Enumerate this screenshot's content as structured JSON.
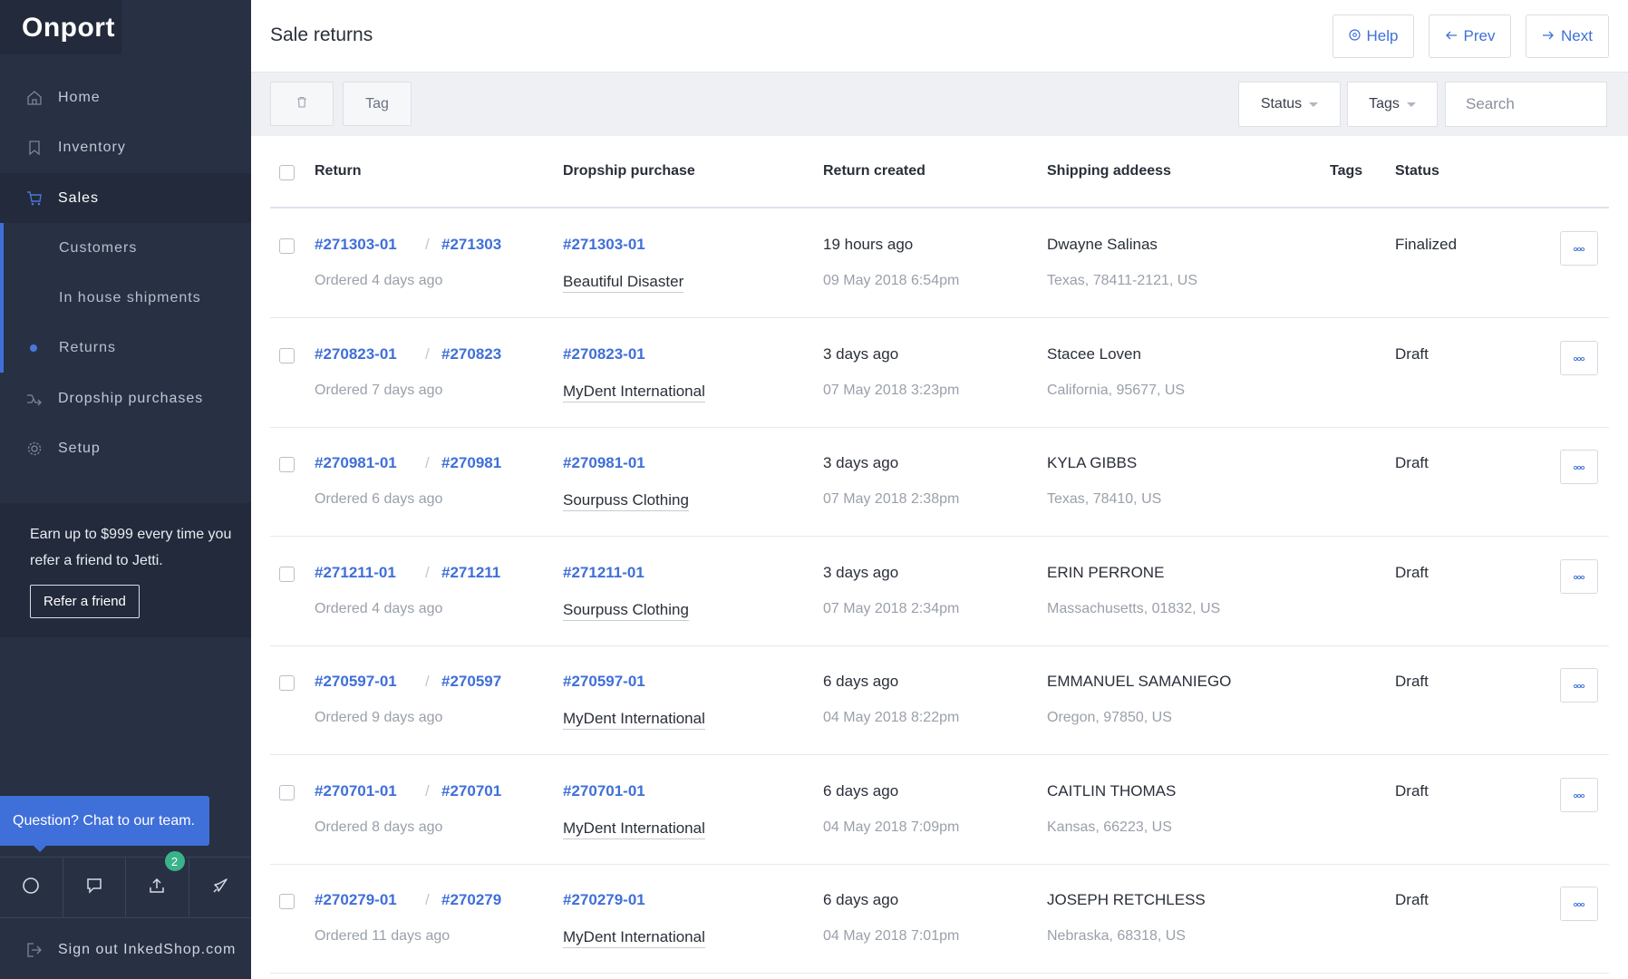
{
  "app": {
    "brand": "Onport"
  },
  "sidebar": {
    "items": [
      {
        "label": "Home",
        "icon": "home-icon"
      },
      {
        "label": "Inventory",
        "icon": "bookmark-icon"
      },
      {
        "label": "Sales",
        "icon": "cart-icon"
      },
      {
        "label": "Customers"
      },
      {
        "label": "In house shipments"
      },
      {
        "label": "Returns"
      },
      {
        "label": "Dropship purchases",
        "icon": "dropship-icon"
      },
      {
        "label": "Setup",
        "icon": "gear-icon"
      }
    ],
    "promo": {
      "text": "Earn up to $999 every time you refer a friend to Jetti.",
      "button": "Refer a friend"
    },
    "chat": "Question? Chat to our team.",
    "notification_count": "2",
    "signout": "Sign out InkedShop.com"
  },
  "header": {
    "title": "Sale returns",
    "help": "Help",
    "prev": "Prev",
    "next": "Next"
  },
  "toolbar": {
    "tag": "Tag",
    "status": "Status",
    "tags": "Tags",
    "search_placeholder": "Search"
  },
  "table": {
    "columns": {
      "return": "Return",
      "dropship": "Dropship purchase",
      "created": "Return created",
      "address": "Shipping addeess",
      "tags": "Tags",
      "status": "Status"
    },
    "rows": [
      {
        "return_id": "#271303-01",
        "order_id": "#271303",
        "ordered": "Ordered 4 days ago",
        "dropship_id": "#271303-01",
        "vendor": "Beautiful Disaster",
        "created": "19 hours ago",
        "created_date": "09 May 2018 6:54pm",
        "name": "Dwayne Salinas",
        "region": "Texas, 78411-2121, US",
        "status": "Finalized"
      },
      {
        "return_id": "#270823-01",
        "order_id": "#270823",
        "ordered": "Ordered 7 days ago",
        "dropship_id": "#270823-01",
        "vendor": "MyDent International",
        "created": "3 days ago",
        "created_date": "07 May 2018 3:23pm",
        "name": "Stacee Loven",
        "region": "California, 95677, US",
        "status": "Draft"
      },
      {
        "return_id": "#270981-01",
        "order_id": "#270981",
        "ordered": "Ordered 6 days ago",
        "dropship_id": "#270981-01",
        "vendor": "Sourpuss Clothing",
        "created": "3 days ago",
        "created_date": "07 May 2018 2:38pm",
        "name": "KYLA GIBBS",
        "region": "Texas, 78410, US",
        "status": "Draft"
      },
      {
        "return_id": "#271211-01",
        "order_id": "#271211",
        "ordered": "Ordered 4 days ago",
        "dropship_id": "#271211-01",
        "vendor": "Sourpuss Clothing",
        "created": "3 days ago",
        "created_date": "07 May 2018 2:34pm",
        "name": "ERIN PERRONE",
        "region": "Massachusetts, 01832, US",
        "status": "Draft"
      },
      {
        "return_id": "#270597-01",
        "order_id": "#270597",
        "ordered": "Ordered 9 days ago",
        "dropship_id": "#270597-01",
        "vendor": "MyDent International",
        "created": "6 days ago",
        "created_date": "04 May 2018 8:22pm",
        "name": "EMMANUEL SAMANIEGO",
        "region": "Oregon, 97850, US",
        "status": "Draft"
      },
      {
        "return_id": "#270701-01",
        "order_id": "#270701",
        "ordered": "Ordered 8 days ago",
        "dropship_id": "#270701-01",
        "vendor": "MyDent International",
        "created": "6 days ago",
        "created_date": "04 May 2018 7:09pm",
        "name": "CAITLIN THOMAS",
        "region": "Kansas, 66223, US",
        "status": "Draft"
      },
      {
        "return_id": "#270279-01",
        "order_id": "#270279",
        "ordered": "Ordered 11 days ago",
        "dropship_id": "#270279-01",
        "vendor": "MyDent International",
        "created": "6 days ago",
        "created_date": "04 May 2018 7:01pm",
        "name": "JOSEPH RETCHLESS",
        "region": "Nebraska, 68318, US",
        "status": "Draft"
      }
    ]
  },
  "colors": {
    "sidebar": "#283044",
    "accent": "#3f6fd9",
    "badge": "#39b38a"
  }
}
